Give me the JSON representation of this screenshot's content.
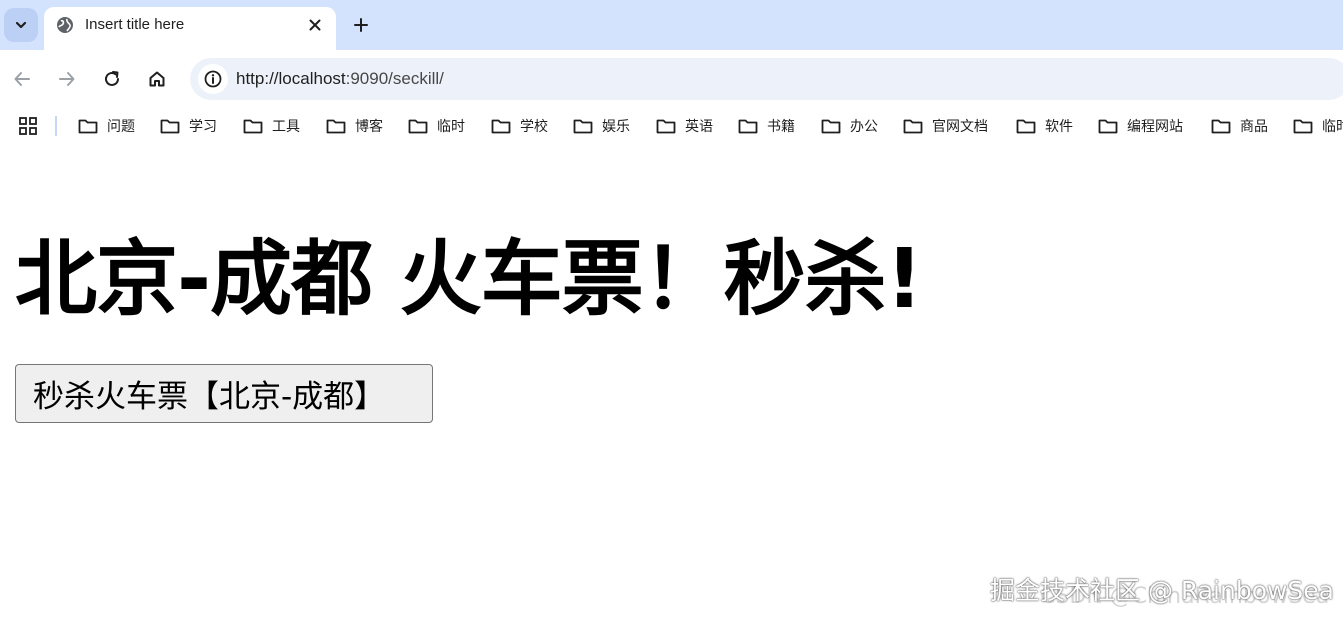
{
  "tab": {
    "title": "Insert title here",
    "favicon": "globe-icon",
    "close_icon": "close-icon"
  },
  "toolbar": {
    "back_icon": "arrow-left-icon",
    "forward_icon": "arrow-right-icon",
    "reload_icon": "reload-icon",
    "home_icon": "home-icon",
    "site_info_icon": "info-icon",
    "url_host": "http://localhost",
    "url_path": ":9090/seckill/"
  },
  "bookmarks": {
    "apps_icon": "grid-icon",
    "items": [
      {
        "label": "问题"
      },
      {
        "label": "学习"
      },
      {
        "label": "工具"
      },
      {
        "label": "博客"
      },
      {
        "label": "临时"
      },
      {
        "label": "学校"
      },
      {
        "label": "娱乐"
      },
      {
        "label": "英语"
      },
      {
        "label": "书籍"
      },
      {
        "label": "办公"
      },
      {
        "label": "官网文档"
      },
      {
        "label": "软件"
      },
      {
        "label": "编程网站"
      },
      {
        "label": "商品"
      },
      {
        "label": "临时"
      }
    ]
  },
  "page": {
    "heading": "北京-成都 火车票！秒杀!",
    "button_label": "秒杀火车票【北京-成都】"
  },
  "watermark": {
    "front": "掘金技术社区 @ RainbowSea",
    "back": "CSDN @ChinaRainbowSea"
  },
  "colors": {
    "tabstrip": "#d3e3fd",
    "omnibox": "#edf2fa",
    "button_bg": "#efefef"
  }
}
